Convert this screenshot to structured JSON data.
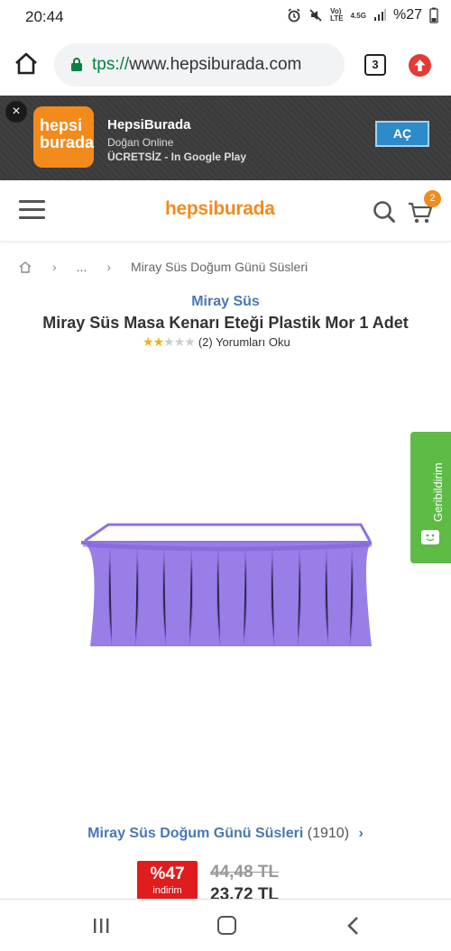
{
  "status_bar": {
    "time": "20:44",
    "network": "4.5G",
    "battery": "%27"
  },
  "browser": {
    "url_prefix": "tps://",
    "url_host": "www.hepsiburada.com",
    "tab_count": "3"
  },
  "app_banner": {
    "close_label": "×",
    "icon_text_line1": "hepsi",
    "icon_text_line2": "burada",
    "app_name": "HepsiBurada",
    "developer": "Doğan Online",
    "price": "ÜCRETSİZ - In Google Play",
    "open_label": "AÇ"
  },
  "header": {
    "logo": "hepsiburada",
    "cart_count": "2"
  },
  "breadcrumb": {
    "sep": "›",
    "ellipsis": "...",
    "current": "Miray Süs Doğum Günü Süsleri"
  },
  "product": {
    "brand": "Miray Süs",
    "title": "Miray Süs Masa Kenarı Eteği Plastik Mor 1 Adet",
    "rating": 2,
    "rating_max": 5,
    "reviews": "(2) Yorumları Oku"
  },
  "feedback": {
    "label": "Geribildirim"
  },
  "category": {
    "name": "Miray Süs Doğum Günü Süsleri",
    "count": "(1910)",
    "chevron": "›"
  },
  "pricing": {
    "discount_pct": "%47",
    "discount_label": "indirim",
    "old_price": "44,48 TL",
    "new_price": "23,72 TL"
  },
  "colors": {
    "brand_orange": "#f28b1c",
    "link_blue": "#4a77b4",
    "discount_red": "#e01c1c",
    "feedback_green": "#5dbb46",
    "product_purple": "#9a7ee8"
  }
}
